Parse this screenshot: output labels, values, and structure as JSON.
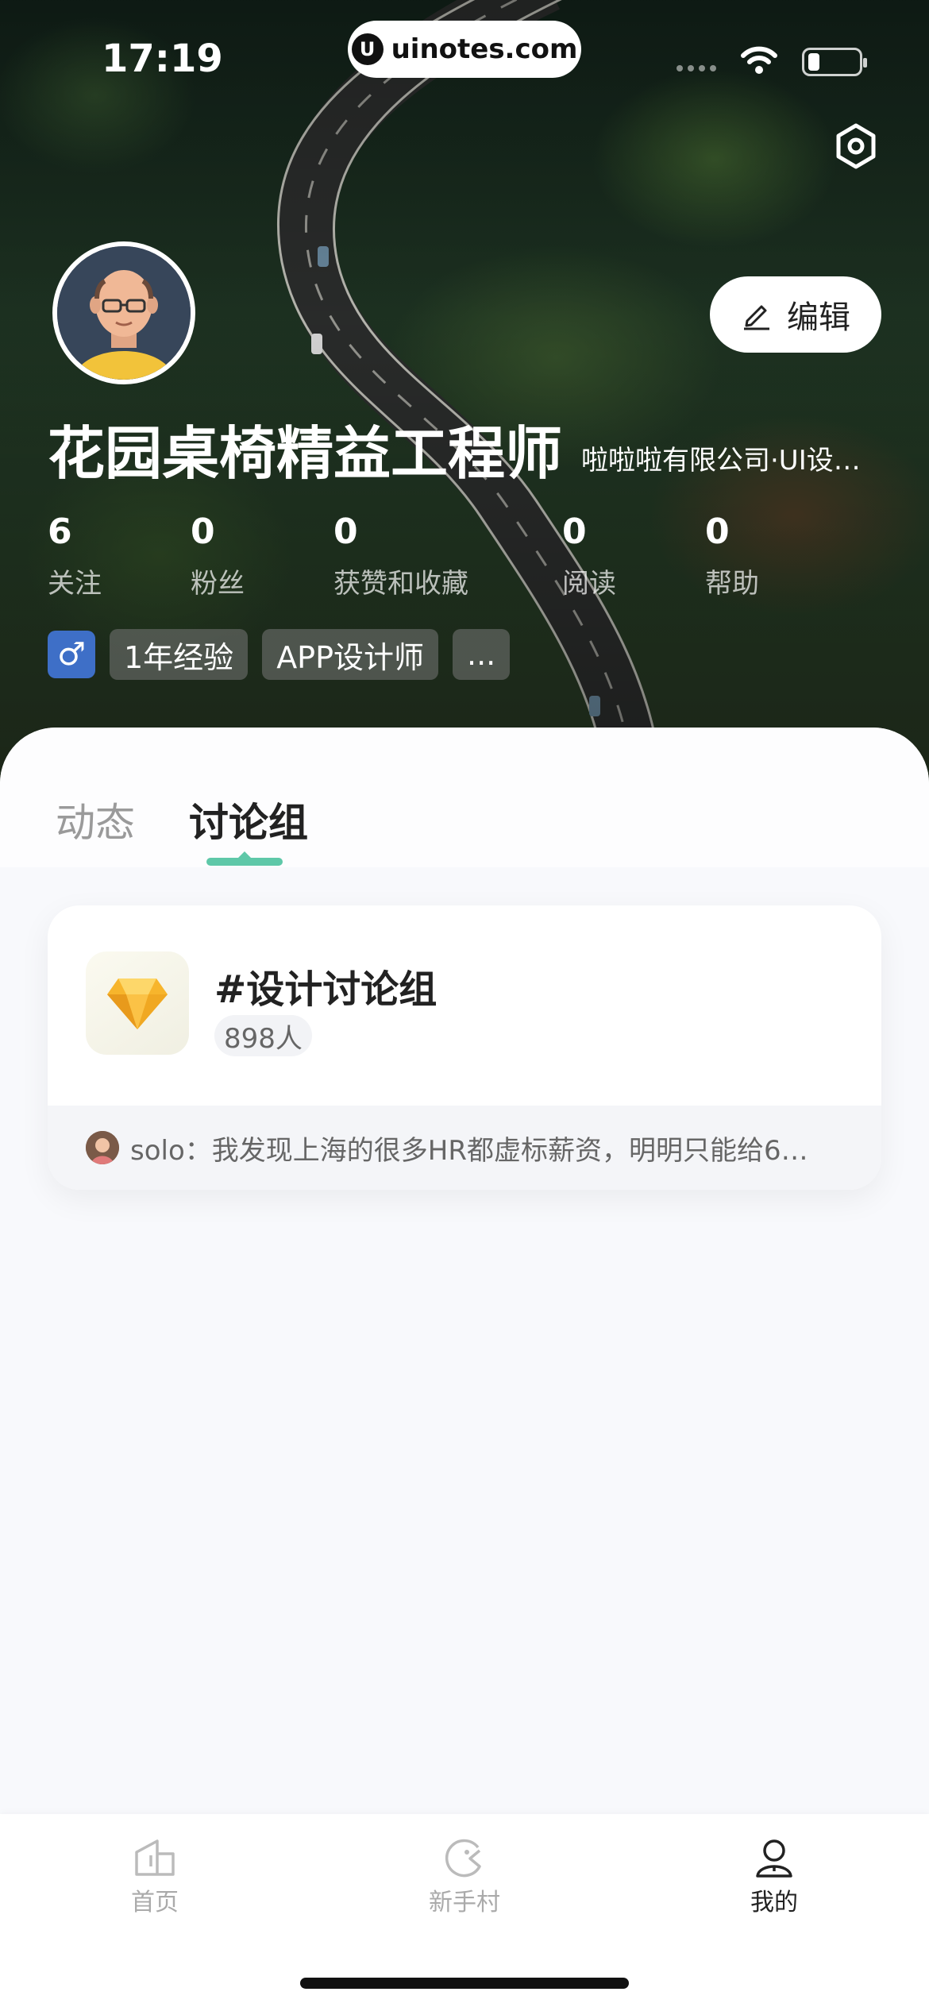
{
  "status_bar": {
    "time": "17:19",
    "url": "uinotes.com",
    "url_logo": "U"
  },
  "profile": {
    "name": "花园桌椅精益工程师",
    "company": "啦啦啦有限公司·UI设…",
    "edit_label": "编辑",
    "stats": [
      {
        "value": "6",
        "label": "关注"
      },
      {
        "value": "0",
        "label": "粉丝"
      },
      {
        "value": "0",
        "label": "获赞和收藏"
      },
      {
        "value": "0",
        "label": "阅读"
      },
      {
        "value": "0",
        "label": "帮助"
      }
    ],
    "tags": {
      "gender": "♂",
      "experience": "1年经验",
      "role": "APP设计师",
      "more": "..."
    }
  },
  "tabs": {
    "dynamics": "动态",
    "groups": "讨论组"
  },
  "group_card": {
    "title": "#设计讨论组",
    "members": "898人",
    "preview": "solo：我发现上海的很多HR都虚标薪资，明明只能给6…"
  },
  "tabbar": {
    "home": "首页",
    "newbie": "新手村",
    "mine": "我的"
  },
  "colors": {
    "accent": "#5ec8a8",
    "gender_tag": "#3e6fc7"
  }
}
